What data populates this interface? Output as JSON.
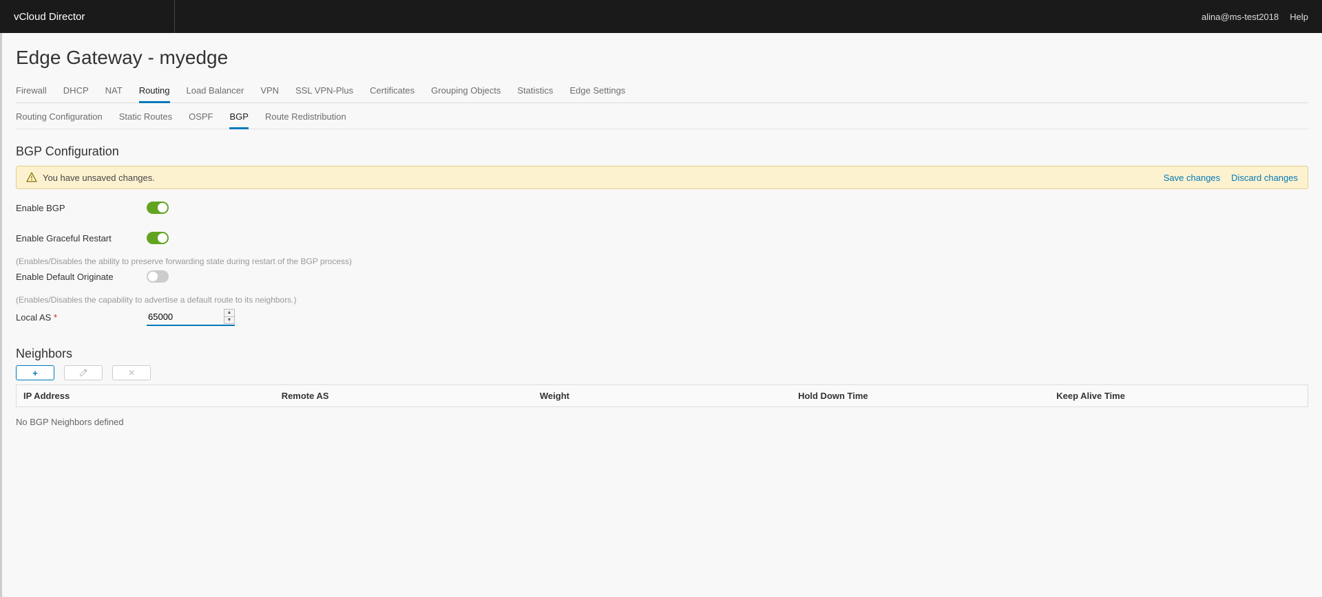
{
  "header": {
    "appTitle": "vCloud Director",
    "user": "alina@ms-test2018",
    "help": "Help"
  },
  "page": {
    "title": "Edge Gateway - myedge"
  },
  "tabsPrimary": [
    "Firewall",
    "DHCP",
    "NAT",
    "Routing",
    "Load Balancer",
    "VPN",
    "SSL VPN-Plus",
    "Certificates",
    "Grouping Objects",
    "Statistics",
    "Edge Settings"
  ],
  "tabsPrimaryActive": 3,
  "tabsSecondary": [
    "Routing Configuration",
    "Static Routes",
    "OSPF",
    "BGP",
    "Route Redistribution"
  ],
  "tabsSecondaryActive": 3,
  "sections": {
    "bgpConfigTitle": "BGP Configuration",
    "neighborsTitle": "Neighbors"
  },
  "alert": {
    "message": "You have unsaved changes.",
    "save": "Save changes",
    "discard": "Discard changes"
  },
  "form": {
    "enableBGP": {
      "label": "Enable BGP",
      "value": true
    },
    "enableGracefulRestart": {
      "label": "Enable Graceful Restart",
      "value": true,
      "hint": "(Enables/Disables the ability to preserve forwarding state during restart of the BGP process)"
    },
    "enableDefaultOriginate": {
      "label": "Enable Default Originate",
      "value": false,
      "hint": "(Enables/Disables the capability to advertise a default route to its neighbors.)"
    },
    "localAS": {
      "label": "Local AS",
      "value": "65000"
    }
  },
  "neighborsTable": {
    "columns": [
      "IP Address",
      "Remote AS",
      "Weight",
      "Hold Down Time",
      "Keep Alive Time"
    ],
    "emptyMessage": "No BGP Neighbors defined"
  }
}
